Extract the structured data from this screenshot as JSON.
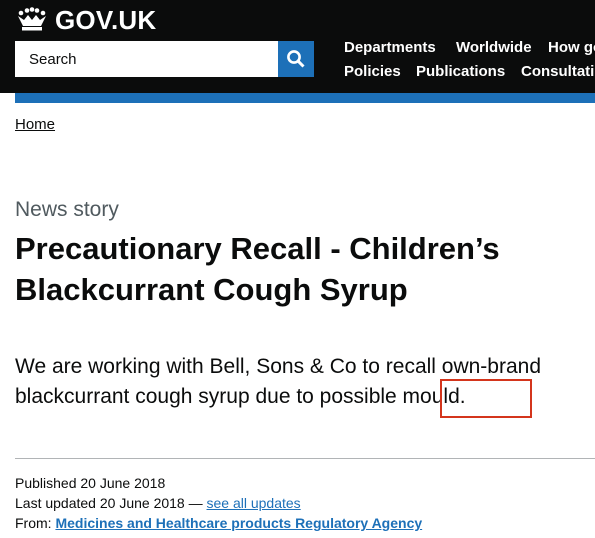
{
  "header": {
    "logo_text": "GOV.UK",
    "search": {
      "placeholder": "Search"
    },
    "nav": {
      "departments": "Departments",
      "worldwide": "Worldwide",
      "how_gov_works": "How go",
      "policies": "Policies",
      "publications": "Publications",
      "consultations": "Consultatio"
    }
  },
  "breadcrumb": {
    "home": "Home"
  },
  "page": {
    "doc_type": "News story",
    "title_line1": "Precautionary Recall - Children’s",
    "title_line2": "Blackcurrant Cough Syrup",
    "lead_line1": "We are working with Bell, Sons & Co to recall own-brand",
    "lead_line2": "blackcurrant cough syrup due to possible mould."
  },
  "metadata": {
    "published_label": "Published",
    "published_date": "20 June 2018",
    "updated_label": "Last updated",
    "updated_date": "20 June 2018 —",
    "see_all_updates": "see all updates",
    "from_label": "From:",
    "organisation": "Medicines and Healthcare products Regulatory Agency"
  },
  "colors": {
    "header_bg": "#0b0c0c",
    "brand_blue": "#1d70b8",
    "highlight_red": "#d4351c",
    "secondary_text": "#505a5f"
  }
}
